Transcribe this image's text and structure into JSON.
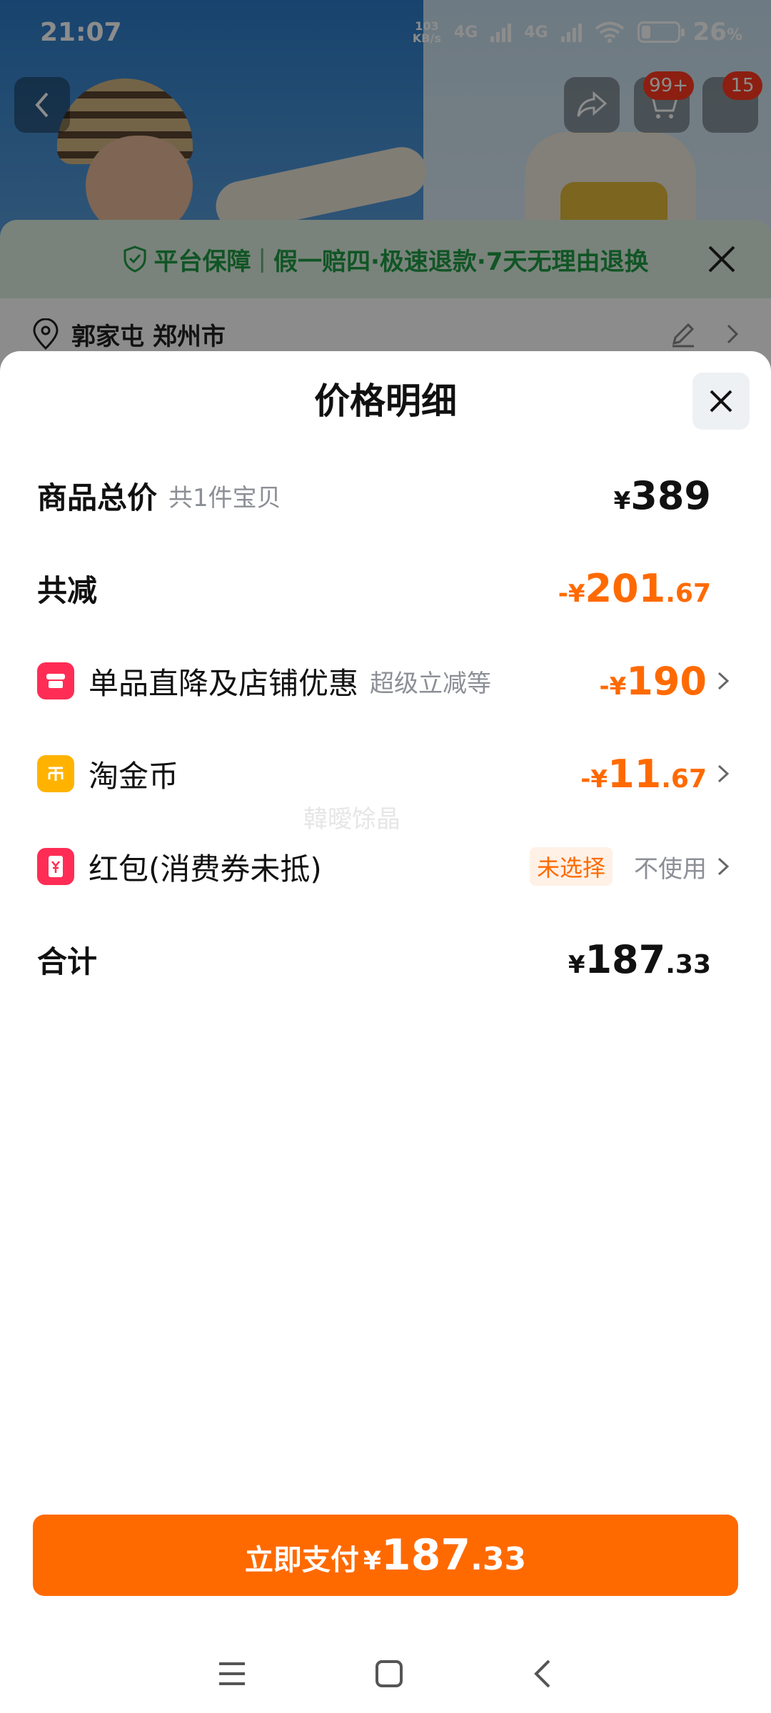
{
  "status_bar": {
    "time": "21:07",
    "net_speed_top": "103",
    "net_speed_bottom": "KB/s",
    "sim1": "4G",
    "sim2": "4G",
    "battery_percent": "26",
    "battery_suffix": "%",
    "battery_level": 0.26
  },
  "product_page": {
    "cart_badge": "99+",
    "menu_badge": "15",
    "guarantee": {
      "title": "平台保障",
      "divider": "|",
      "text": "假一赔四·极速退款·7天无理由退换"
    },
    "address": "郭家屯 郑州市"
  },
  "sheet": {
    "title": "价格明细",
    "total": {
      "label": "商品总价",
      "sub": "共1件宝贝",
      "yen": "¥",
      "integer": "389"
    },
    "reduction": {
      "label": "共减",
      "sign": "-",
      "yen": "¥",
      "integer": "201",
      "decimal": ".67"
    },
    "items": [
      {
        "label": "单品直降及店铺优惠",
        "sub": "超级立减等",
        "sign": "-",
        "yen": "¥",
        "integer": "190",
        "decimal": ""
      },
      {
        "label": "淘金币",
        "sign": "-",
        "yen": "¥",
        "integer": "11",
        "decimal": ".67"
      },
      {
        "label": "红包(消费券未抵)",
        "tag": "未选择",
        "value": "不使用"
      }
    ],
    "watermark": "韓曖馀晶",
    "sum": {
      "label": "合计",
      "yen": "¥",
      "integer": "187",
      "decimal": ".33"
    },
    "pay_button": {
      "label": "立即支付",
      "yen": "¥",
      "integer": "187",
      "decimal": ".33"
    }
  },
  "colors": {
    "accent": "#ff6a00",
    "guarantee_green": "#1f9c44",
    "shop_icon": "#ff2d55",
    "coin_icon": "#ffb300",
    "redpacket_icon": "#ff2d55"
  }
}
